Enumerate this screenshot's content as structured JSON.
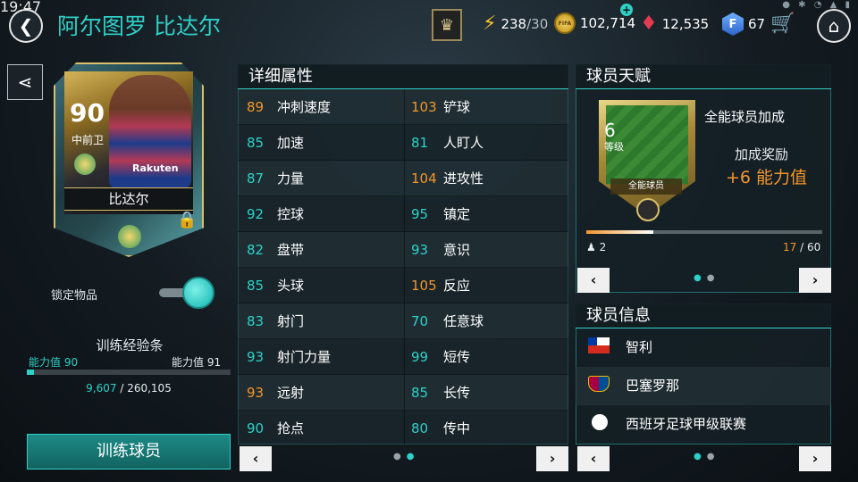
{
  "status": {
    "time": "19:47"
  },
  "header": {
    "title": "阿尔图罗 比达尔",
    "stamina": "238",
    "stamina_max": "/30",
    "coins": "102,714",
    "gems": "12,535",
    "fifa_points": "67",
    "coin_label": "FIFA",
    "fpts_label": "F"
  },
  "card": {
    "rating": "90",
    "position": "中前卫",
    "name": "比达尔",
    "sponsor": "Rakuten"
  },
  "lock": {
    "label": "锁定物品",
    "on": true
  },
  "training": {
    "title": "训练经验条",
    "left_label": "能力值 90",
    "right_label": "能力值  91",
    "progress": 0.037,
    "current": "9,607",
    "sep": " / ",
    "total": "260,105",
    "button": "训练球员"
  },
  "stats": {
    "title": "详细属性",
    "left": [
      {
        "value": "89",
        "name": "冲刺速度",
        "color": "#f2962b"
      },
      {
        "value": "85",
        "name": "加速",
        "color": "#2fd0c7"
      },
      {
        "value": "87",
        "name": "力量",
        "color": "#2fd0c7"
      },
      {
        "value": "92",
        "name": "控球",
        "color": "#2fd0c7"
      },
      {
        "value": "82",
        "name": "盘带",
        "color": "#2fd0c7"
      },
      {
        "value": "85",
        "name": "头球",
        "color": "#2fd0c7"
      },
      {
        "value": "83",
        "name": "射门",
        "color": "#2fd0c7"
      },
      {
        "value": "93",
        "name": "射门力量",
        "color": "#2fd0c7"
      },
      {
        "value": "93",
        "name": "远射",
        "color": "#f2962b"
      },
      {
        "value": "90",
        "name": "抢点",
        "color": "#2fd0c7"
      }
    ],
    "right": [
      {
        "value": "103",
        "name": "铲球",
        "color": "#f2962b"
      },
      {
        "value": "81",
        "name": "人盯人",
        "color": "#2fd0c7"
      },
      {
        "value": "104",
        "name": "进攻性",
        "color": "#f2962b"
      },
      {
        "value": "95",
        "name": "镇定",
        "color": "#2fd0c7"
      },
      {
        "value": "93",
        "name": "意识",
        "color": "#2fd0c7"
      },
      {
        "value": "105",
        "name": "反应",
        "color": "#f2962b"
      },
      {
        "value": "70",
        "name": "任意球",
        "color": "#2fd0c7"
      },
      {
        "value": "99",
        "name": "短传",
        "color": "#2fd0c7"
      },
      {
        "value": "85",
        "name": "长传",
        "color": "#2fd0c7"
      },
      {
        "value": "80",
        "name": "传中",
        "color": "#2fd0c7"
      }
    ],
    "prev": "‹",
    "next": "›"
  },
  "talent": {
    "title": "球员天赋",
    "level": "6",
    "level_label": "等级",
    "badge_name": "全能球员",
    "name": "全能球员加成",
    "bonus_label": "加成奖励",
    "bonus_value": "+6 能力值",
    "people": "2",
    "progress_cur": "17",
    "progress_sep": " / ",
    "progress_max": "60",
    "progress": 0.283
  },
  "info": {
    "title": "球员信息",
    "nation": "智利",
    "club": "巴塞罗那",
    "league": "西班牙足球甲级联赛"
  }
}
